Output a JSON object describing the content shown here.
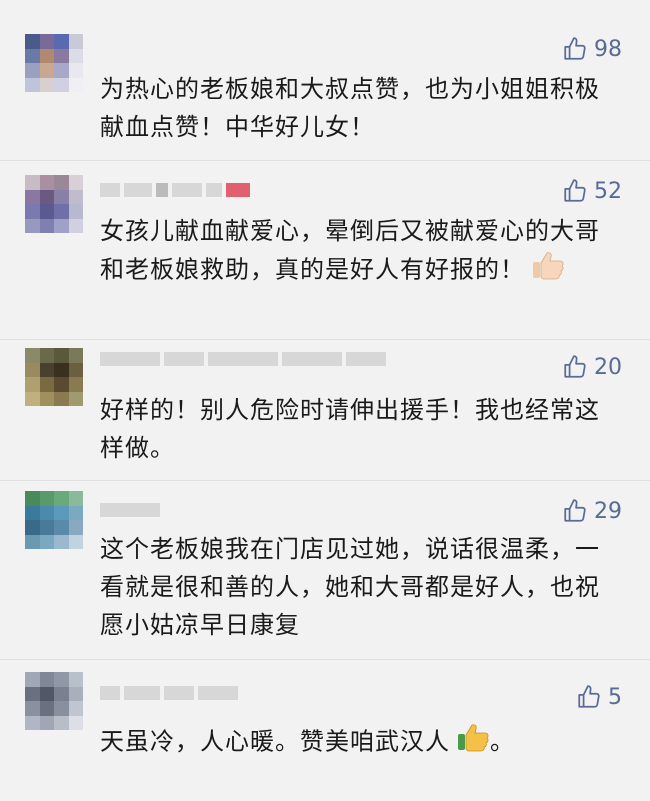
{
  "comments": [
    {
      "likes": "98",
      "text": "为热心的老板娘和大叔点赞，也为小姐姐积极献血点赞！中华好儿女！",
      "emoji": ""
    },
    {
      "likes": "52",
      "text": "女孩儿献血献爱心，晕倒后又被献爱心的大哥和老板娘救助，真的是好人有好报的！",
      "emoji": "thumbs-up-emoji"
    },
    {
      "likes": "20",
      "text": "好样的！别人危险时请伸出援手！我也经常这样做。",
      "emoji": ""
    },
    {
      "likes": "29",
      "text": "这个老板娘我在门店见过她，说话很温柔，一看就是很和善的人，她和大哥都是好人，也祝愿小姑凉早日康复",
      "emoji": ""
    },
    {
      "likes": "5",
      "text": "天虽冷，人心暖。赞美咱武汉人",
      "text_suffix": "。",
      "emoji": "thumbs-up-emoji"
    }
  ],
  "colors": {
    "like": "#576b95",
    "text": "#1a1a1a",
    "background": "#f2f2f2"
  },
  "icons": {
    "like": "thumbs-up-outline-icon"
  }
}
